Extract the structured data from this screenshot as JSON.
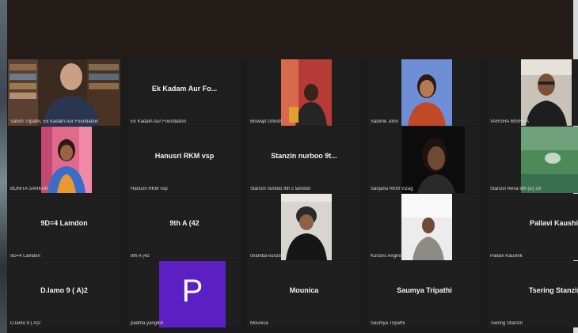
{
  "participants": [
    {
      "caption": "Satish Tripathi, Ek Kadam Aur Foundation",
      "center": "",
      "video": "video-man-bookshelf"
    },
    {
      "caption": "Ek Kadam Aur Foundation",
      "center": "Ek Kadam Aur Fo...",
      "video": ""
    },
    {
      "caption": "Biswajit Ghosh",
      "center": "",
      "video": "video-red-room"
    },
    {
      "caption": "Salome John",
      "center": "",
      "video": "video-woman-blue-wall"
    },
    {
      "caption": "VARSHA MISHRA",
      "center": "",
      "video": "video-man-glasses"
    },
    {
      "caption": "BONITA SARKAR",
      "center": "",
      "video": "video-woman-pink-curtain"
    },
    {
      "caption": "Hanusri RKM vsp",
      "center": "Hanusri RKM vsp",
      "video": ""
    },
    {
      "caption": "Stanzin nurboo 9th c lamdon",
      "center": "Stanzin nurboo 9t...",
      "video": ""
    },
    {
      "caption": "Sanjana RKM Vizag",
      "center": "",
      "video": "video-girl-dark"
    },
    {
      "caption": "Stanzin Reva 9th (D) 29",
      "center": "",
      "video": "video-green-screen"
    },
    {
      "caption": "9D=4 Lamdon",
      "center": "9D=4 Lamdon",
      "video": ""
    },
    {
      "caption": "9th  A  (42",
      "center": "9th  A  (42",
      "video": ""
    },
    {
      "caption": "chamba kunzes",
      "center": "",
      "video": "video-person-beanie"
    },
    {
      "caption": "Kunzes Angmo",
      "center": "",
      "video": "video-person-white-room"
    },
    {
      "caption": "Pallavi Kaushik",
      "center": "Pallavi Kaushik",
      "video": ""
    },
    {
      "caption": "D.lamo 9 ( A)2",
      "center": "D.lamo 9 ( A)2",
      "video": ""
    },
    {
      "caption": "padma yangdol",
      "center": "",
      "video": "avatar",
      "avatar_letter": "P",
      "avatar_color": "#5b1fc4"
    },
    {
      "caption": "Mounica",
      "center": "Mounica",
      "video": ""
    },
    {
      "caption": "Saumya Tripathi",
      "center": "Saumya Tripathi",
      "video": ""
    },
    {
      "caption": "Tsering Stanzin",
      "center": "Tsering Stanzin",
      "video": ""
    }
  ]
}
